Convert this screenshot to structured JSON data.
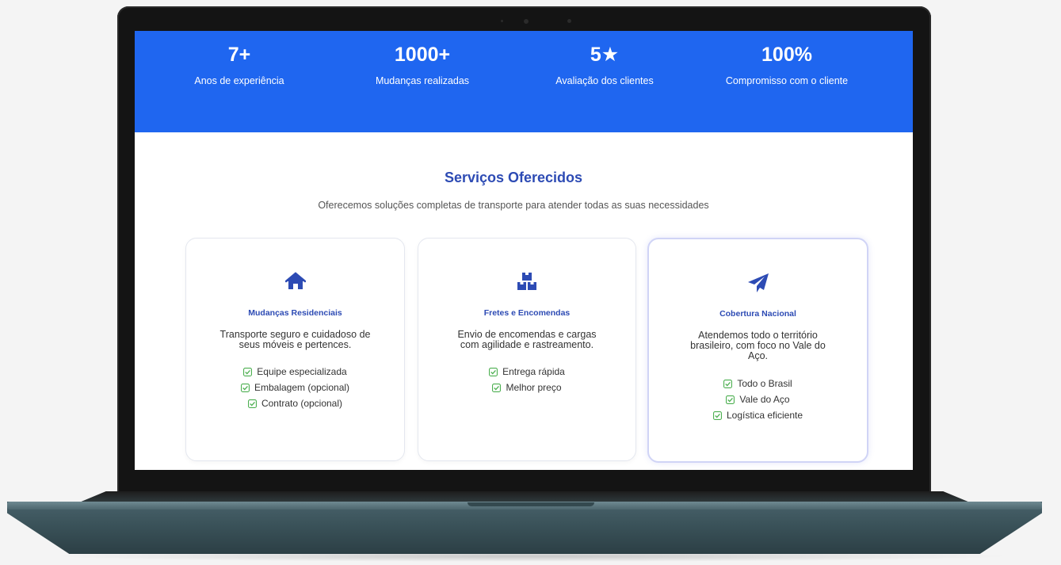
{
  "stats": [
    {
      "value": "7+",
      "label": "Anos de experiência"
    },
    {
      "value": "1000+",
      "label": "Mudanças realizadas"
    },
    {
      "value": "5★",
      "label": "Avaliação dos clientes"
    },
    {
      "value": "100%",
      "label": "Compromisso com o cliente"
    }
  ],
  "services": {
    "title": "Serviços Oferecidos",
    "subtitle": "Oferecemos soluções completas de transporte para atender todas as suas necessidades",
    "cards": [
      {
        "icon": "house-icon",
        "title": "Mudanças Residenciais",
        "description": "Transporte seguro e cuidadoso de seus móveis e pertences.",
        "features": [
          "Equipe especializada",
          "Embalagem (opcional)",
          "Contrato (opcional)"
        ]
      },
      {
        "icon": "boxes-icon",
        "title": "Fretes e Encomendas",
        "description": "Envio de encomendas e cargas com agilidade e rastreamento.",
        "features": [
          "Entrega rápida",
          "Melhor preço"
        ]
      },
      {
        "icon": "paper-plane-icon",
        "title": "Cobertura Nacional",
        "description": "Atendemos todo o território brasileiro, com foco no Vale do Aço.",
        "features": [
          "Todo o Brasil",
          "Vale do Aço",
          "Logística eficiente"
        ]
      }
    ]
  },
  "colors": {
    "primary": "#1f66f0",
    "heading": "#2d4bb4",
    "check": "#4caf50"
  }
}
